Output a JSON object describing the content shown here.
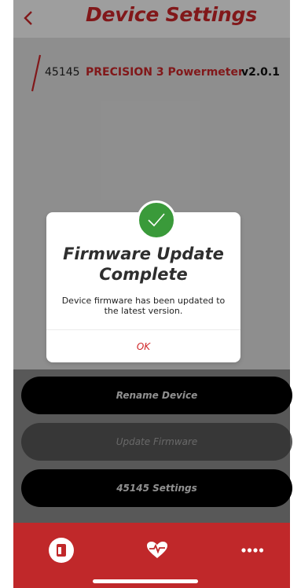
{
  "header": {
    "title": "Device Settings",
    "back_icon": "chevron-left-icon"
  },
  "device": {
    "id": "45145",
    "name": "PRECISION 3 Powermeter",
    "version": "v2.0.1"
  },
  "modal": {
    "icon": "checkmark-icon",
    "title_line1": "Firmware Update",
    "title_line2": "Complete",
    "message_line1": "Device firmware has been updated to",
    "message_line2": "the latest version.",
    "ok_label": "OK"
  },
  "buttons": {
    "rename": "Rename Device",
    "update": "Update Firmware",
    "settings": "45145 Settings"
  },
  "tabbar": {
    "tabs": [
      "device-icon",
      "heart-rate-icon",
      "more-icon"
    ]
  },
  "colors": {
    "accent": "#d0282a",
    "tabbar": "#c0282a",
    "success": "#3a9a3a"
  }
}
